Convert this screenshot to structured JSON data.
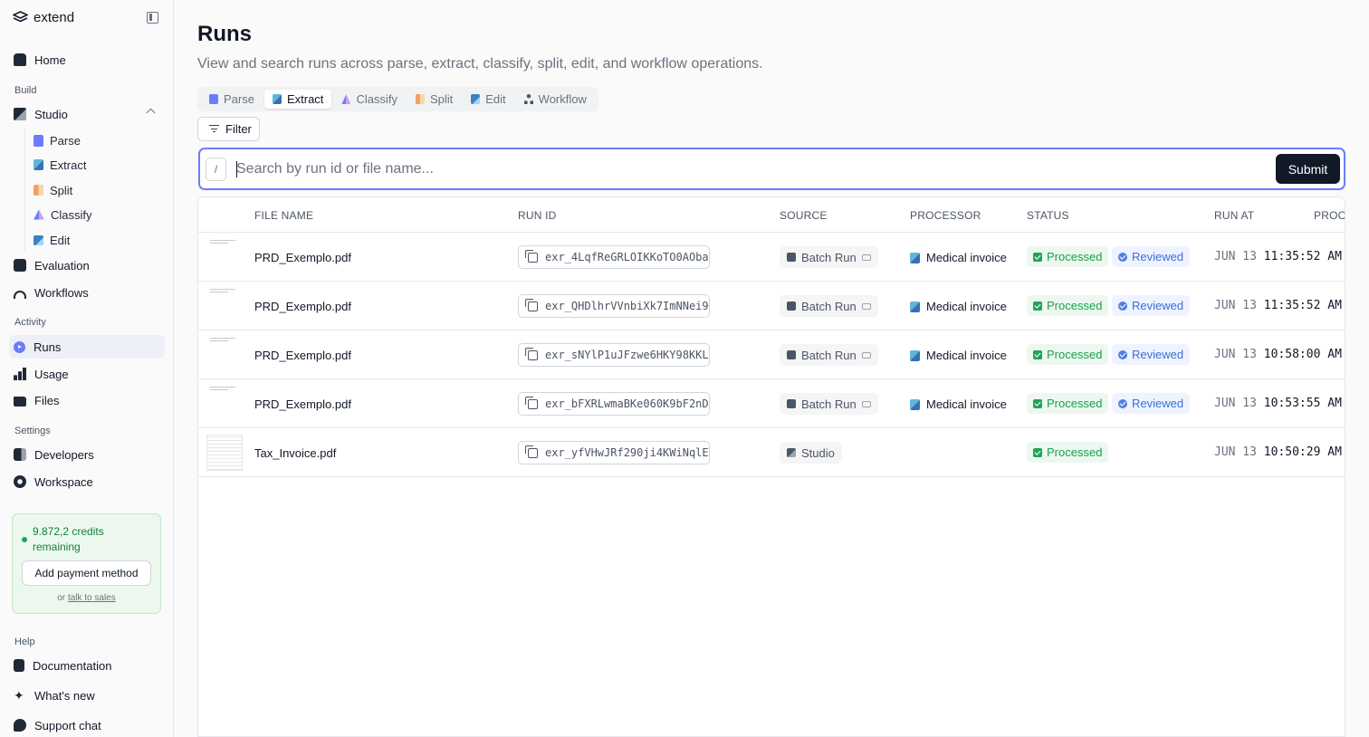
{
  "app": {
    "brand": "extend"
  },
  "sidebar": {
    "home": "Home",
    "build_label": "Build",
    "studio": "Studio",
    "studio_items": [
      "Parse",
      "Extract",
      "Split",
      "Classify",
      "Edit"
    ],
    "evaluation": "Evaluation",
    "workflows": "Workflows",
    "activity_label": "Activity",
    "runs": "Runs",
    "usage": "Usage",
    "files": "Files",
    "settings_label": "Settings",
    "developers": "Developers",
    "workspace": "Workspace",
    "credits_text": "9.872,2 credits remaining",
    "add_payment": "Add payment method",
    "or_text": "or",
    "talk_to_sales": "talk to sales",
    "help_label": "Help",
    "documentation": "Documentation",
    "whats_new": "What's new",
    "support_chat": "Support chat"
  },
  "page": {
    "title": "Runs",
    "subtitle": "View and search runs across parse, extract, classify, split, edit, and workflow operations.",
    "tabs": [
      "Parse",
      "Extract",
      "Classify",
      "Split",
      "Edit",
      "Workflow"
    ],
    "active_tab": "Extract",
    "filter": "Filter",
    "search_shortcut": "/",
    "search_placeholder": "Search by run id or file name...",
    "submit": "Submit"
  },
  "table": {
    "headers": {
      "file_name": "FILE NAME",
      "run_id": "RUN ID",
      "source": "SOURCE",
      "processor": "PROCESSOR",
      "status": "STATUS",
      "run_at": "RUN AT",
      "proc": "PROCI"
    },
    "rows": [
      {
        "file": "PRD_Exemplo.pdf",
        "run_id": "exr_4LqfReGRLOIKKoTO0AOba",
        "source": "Batch Run",
        "processor": "Medical invoice",
        "status": "Processed",
        "review": "Reviewed",
        "date": "JUN 13",
        "time": "11:35:52 AM"
      },
      {
        "file": "PRD_Exemplo.pdf",
        "run_id": "exr_QHDlhrVVnbiXk7ImNNei9",
        "source": "Batch Run",
        "processor": "Medical invoice",
        "status": "Processed",
        "review": "Reviewed",
        "date": "JUN 13",
        "time": "11:35:52 AM"
      },
      {
        "file": "PRD_Exemplo.pdf",
        "run_id": "exr_sNYlP1uJFzwe6HKY98KKL",
        "source": "Batch Run",
        "processor": "Medical invoice",
        "status": "Processed",
        "review": "Reviewed",
        "date": "JUN 13",
        "time": "10:58:00 AM"
      },
      {
        "file": "PRD_Exemplo.pdf",
        "run_id": "exr_bFXRLwmaBKe060K9bF2nD",
        "source": "Batch Run",
        "processor": "Medical invoice",
        "status": "Processed",
        "review": "Reviewed",
        "date": "JUN 13",
        "time": "10:53:55 AM"
      },
      {
        "file": "Tax_Invoice.pdf",
        "run_id": "exr_yfVHwJRf290ji4KWiNqlE",
        "source": "Studio",
        "processor": "",
        "status": "Processed",
        "review": "",
        "date": "JUN 13",
        "time": "10:50:29 AM"
      }
    ]
  },
  "colors": {
    "accent": "#6b7cff",
    "success": "#16a34a",
    "review": "#3b6fd4",
    "dark": "#111827"
  }
}
